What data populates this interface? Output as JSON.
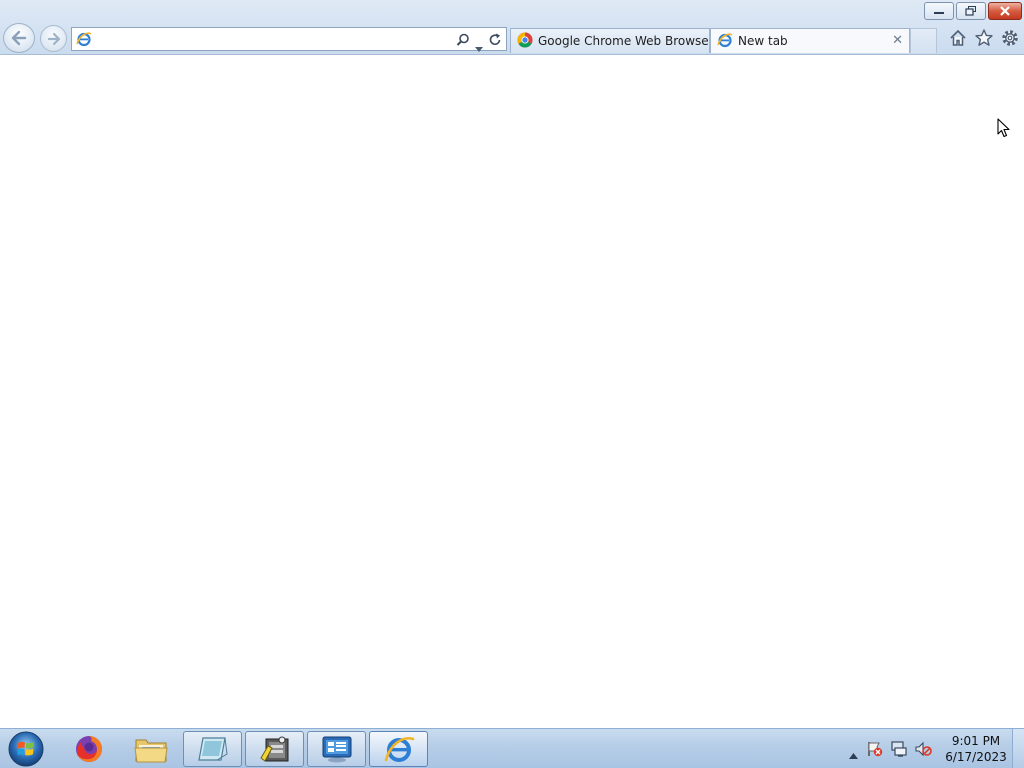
{
  "window": {
    "controls": {
      "minimize_icon": "minimize-icon",
      "restore_icon": "restore-icon",
      "close_icon": "close-icon"
    }
  },
  "navigation": {
    "back_icon": "back-arrow-icon",
    "forward_icon": "forward-arrow-icon"
  },
  "address_bar": {
    "value": "",
    "placeholder": ""
  },
  "tabs": [
    {
      "label": "Google Chrome Web Browser",
      "icon": "chrome-icon",
      "active": false
    },
    {
      "label": "New tab",
      "icon": "ie-icon",
      "active": true,
      "close_glyph": "✕"
    }
  ],
  "command_bar": {
    "icons": [
      "home-icon",
      "favorites-star-icon",
      "tools-gear-icon"
    ]
  },
  "taskbar": {
    "start_icon": "windows-start-orb-icon",
    "pinned": [
      {
        "name": "firefox",
        "icon": "firefox-icon",
        "state": "pinned"
      },
      {
        "name": "file-explorer",
        "icon": "folder-icon",
        "state": "pinned"
      },
      {
        "name": "notepad",
        "icon": "notepad-icon",
        "state": "open"
      },
      {
        "name": "app-tool",
        "icon": "tool-app-icon",
        "state": "open"
      },
      {
        "name": "control-panel",
        "icon": "control-panel-icon",
        "state": "open"
      },
      {
        "name": "internet-explorer",
        "icon": "ie-icon",
        "state": "active"
      }
    ],
    "tray": {
      "icons": [
        "show-hidden-icons-arrow",
        "action-center-flag-icon",
        "network-icon",
        "volume-muted-icon"
      ],
      "time": "9:01 PM",
      "date": "6/17/2023"
    }
  },
  "colors": {
    "frame": "#d4e2f2",
    "taskbar": "#b6cde7",
    "close_button": "#c4391f"
  }
}
